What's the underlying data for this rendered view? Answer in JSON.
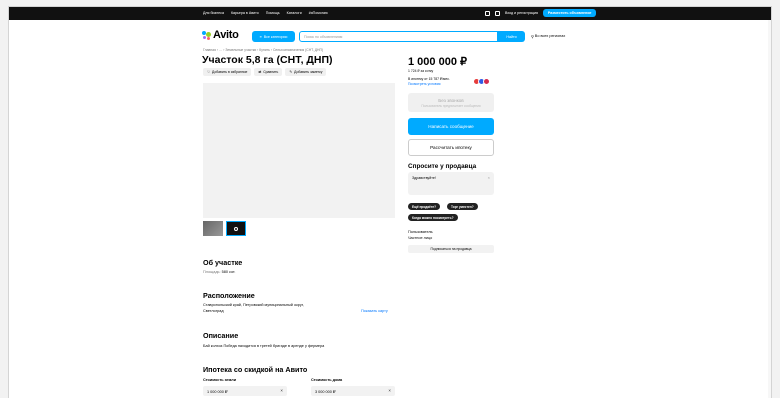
{
  "topbar": {
    "links": [
      "Для бизнеса",
      "Карьера в Авито",
      "Помощь",
      "Каталоги",
      "#яПомогаю"
    ],
    "login": "Вход и регистрация",
    "place_ad": "Разместить объявление"
  },
  "header": {
    "logo": "Avito",
    "all_categories": "Все категории",
    "search_placeholder": "Поиск по объявлениям",
    "find": "Найти",
    "region": "Во всех регионах"
  },
  "listing": {
    "breadcrumbs": "Главная › … › Земельные участки › Купить › Сельхозназначения (СНТ, ДНП)",
    "title": "Участок 5,8 га (СНТ, ДНП)",
    "actions": {
      "favorite": "Добавить в избранное",
      "compare": "Сравнить",
      "note": "Добавить заметку"
    }
  },
  "about": {
    "heading": "Об участке",
    "area_label": "Площадь:",
    "area_value": "580 сот."
  },
  "location": {
    "heading": "Расположение",
    "address_line1": "Ставропольский край, Петровский муниципальный округ,",
    "address_line2": "Светлоград",
    "show_map": "Показать карту"
  },
  "description": {
    "heading": "Описание",
    "text": "Бай колхоз Победа находится в третей бригаде в аренде у фермера"
  },
  "mortgage": {
    "heading": "Ипотека со скидкой на Авито",
    "land_label": "Стоимость земли",
    "land_value": "1 000 000 ₽",
    "house_label": "Стоимость дома",
    "house_value": "3 000 000 ₽"
  },
  "price_panel": {
    "price": "1 000 000 ₽",
    "per_unit": "1 724 ₽ за сотку",
    "mortgage_text": "В ипотеку от 15 787 ₽/мес.",
    "mortgage_link": "Посмотреть условия",
    "no_calls": "Без звонков",
    "no_calls_sub": "Пользователь предпочитает сообщения",
    "write": "Написать сообщение",
    "calc": "Рассчитать ипотеку"
  },
  "ask": {
    "heading": "Спросите у продавца",
    "placeholder": "Здравствуйте!",
    "chips": [
      "Ещё продаёте?",
      "Торг уместен?",
      "Когда можно посмотреть?"
    ]
  },
  "seller": {
    "type": "Пользователь",
    "kind": "Частное лицо",
    "subscribe": "Подписаться на продавца"
  },
  "colors": {
    "accent": "#00aaff",
    "link": "#0077ff",
    "topbar": "#111111"
  }
}
